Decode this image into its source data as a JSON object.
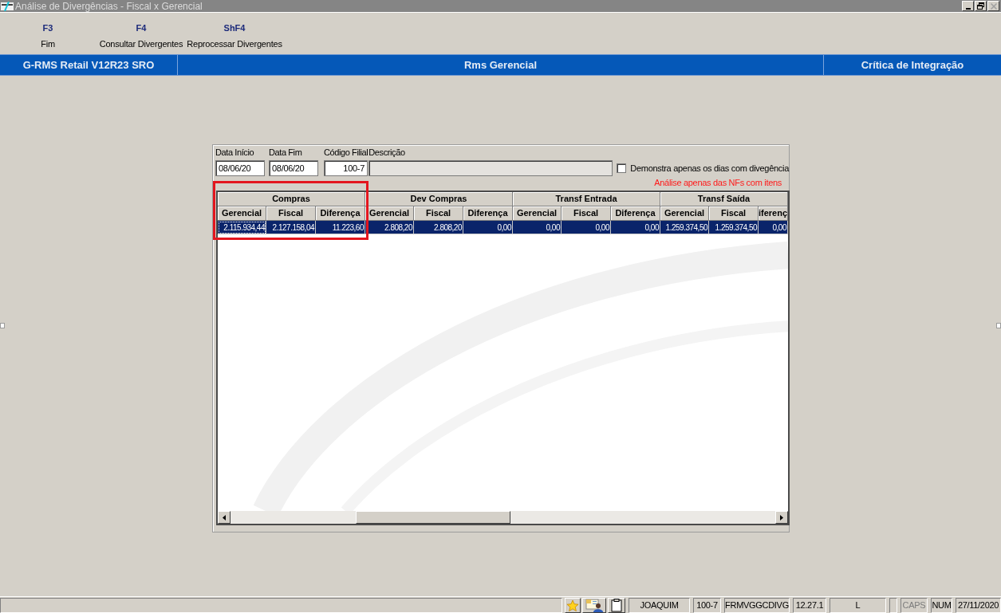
{
  "window": {
    "title": "Análise de Divergências - Fiscal x Gerencial",
    "controls": [
      {
        "kind": "minimize",
        "disabled": false
      },
      {
        "kind": "restore",
        "disabled": false
      },
      {
        "kind": "close",
        "disabled": true
      }
    ]
  },
  "toolbar": [
    {
      "key": "F3",
      "label": "Fim"
    },
    {
      "key": "F4",
      "label": "Consultar Divergentes"
    },
    {
      "key": "ShF4",
      "label": "Reprocessar Divergentes"
    }
  ],
  "banner": [
    "G-RMS Retail V12R23 SRO",
    "Rms Gerencial",
    "Crítica de Integração"
  ],
  "filters": {
    "fields": [
      {
        "label": "Data Início",
        "value": "08/06/20",
        "disabled": false
      },
      {
        "label": "Data Fim",
        "value": "08/06/20",
        "disabled": false
      },
      {
        "label": "Código Filial",
        "value": "100-7",
        "disabled": false
      },
      {
        "label": "Descrição",
        "disabled": true
      }
    ],
    "checkbox": {
      "label": "Demonstra apenas os dias com divegência",
      "checked": false
    },
    "note": "Análise apenas das NFs com itens"
  },
  "grid": {
    "groups": [
      {
        "title": "Compras",
        "highlighted": true,
        "columns": [
          "Gerencial",
          "Fiscal",
          "Diferença"
        ]
      },
      {
        "title": "Dev Compras",
        "highlighted": false,
        "columns": [
          "Gerencial",
          "Fiscal",
          "Diferença"
        ]
      },
      {
        "title": "Transf Entrada",
        "highlighted": false,
        "columns": [
          "Gerencial",
          "Fiscal",
          "Diferença"
        ]
      },
      {
        "title": "Transf Saída",
        "highlighted": false,
        "columns": [
          "Gerencial",
          "Fiscal",
          "iferenç"
        ]
      }
    ],
    "rows": [
      {
        "selected": true,
        "cells": [
          {
            "text": "2.115.934,44",
            "focused": true
          },
          {
            "text": "2.127.158,04",
            "focused": false
          },
          {
            "text": "11.223,60",
            "focused": false
          },
          {
            "text": "2.808,20",
            "focused": false
          },
          {
            "text": "2.808,20",
            "focused": false
          },
          {
            "text": "0,00",
            "focused": false
          },
          {
            "text": "0,00",
            "focused": false
          },
          {
            "text": "0,00",
            "focused": false
          },
          {
            "text": "0,00",
            "focused": false
          },
          {
            "text": "1.259.374,50",
            "focused": false
          },
          {
            "text": "1.259.374,50",
            "focused": false
          },
          {
            "text": "0,00",
            "focused": false
          }
        ]
      }
    ]
  },
  "status_bar": [
    {
      "kind": "text",
      "text": "JOAQUIM"
    },
    {
      "kind": "text",
      "text": "100-7"
    },
    {
      "kind": "text",
      "text": "FRMVGGCDIVG"
    },
    {
      "kind": "text",
      "text": "12.27.1"
    },
    {
      "kind": "text",
      "text": "L"
    },
    {
      "kind": "blank"
    },
    {
      "kind": "indicator",
      "text": "CAPS",
      "on": false
    },
    {
      "kind": "indicator",
      "text": "NUM",
      "on": true
    },
    {
      "kind": "text",
      "text": "27/11/2020"
    }
  ]
}
